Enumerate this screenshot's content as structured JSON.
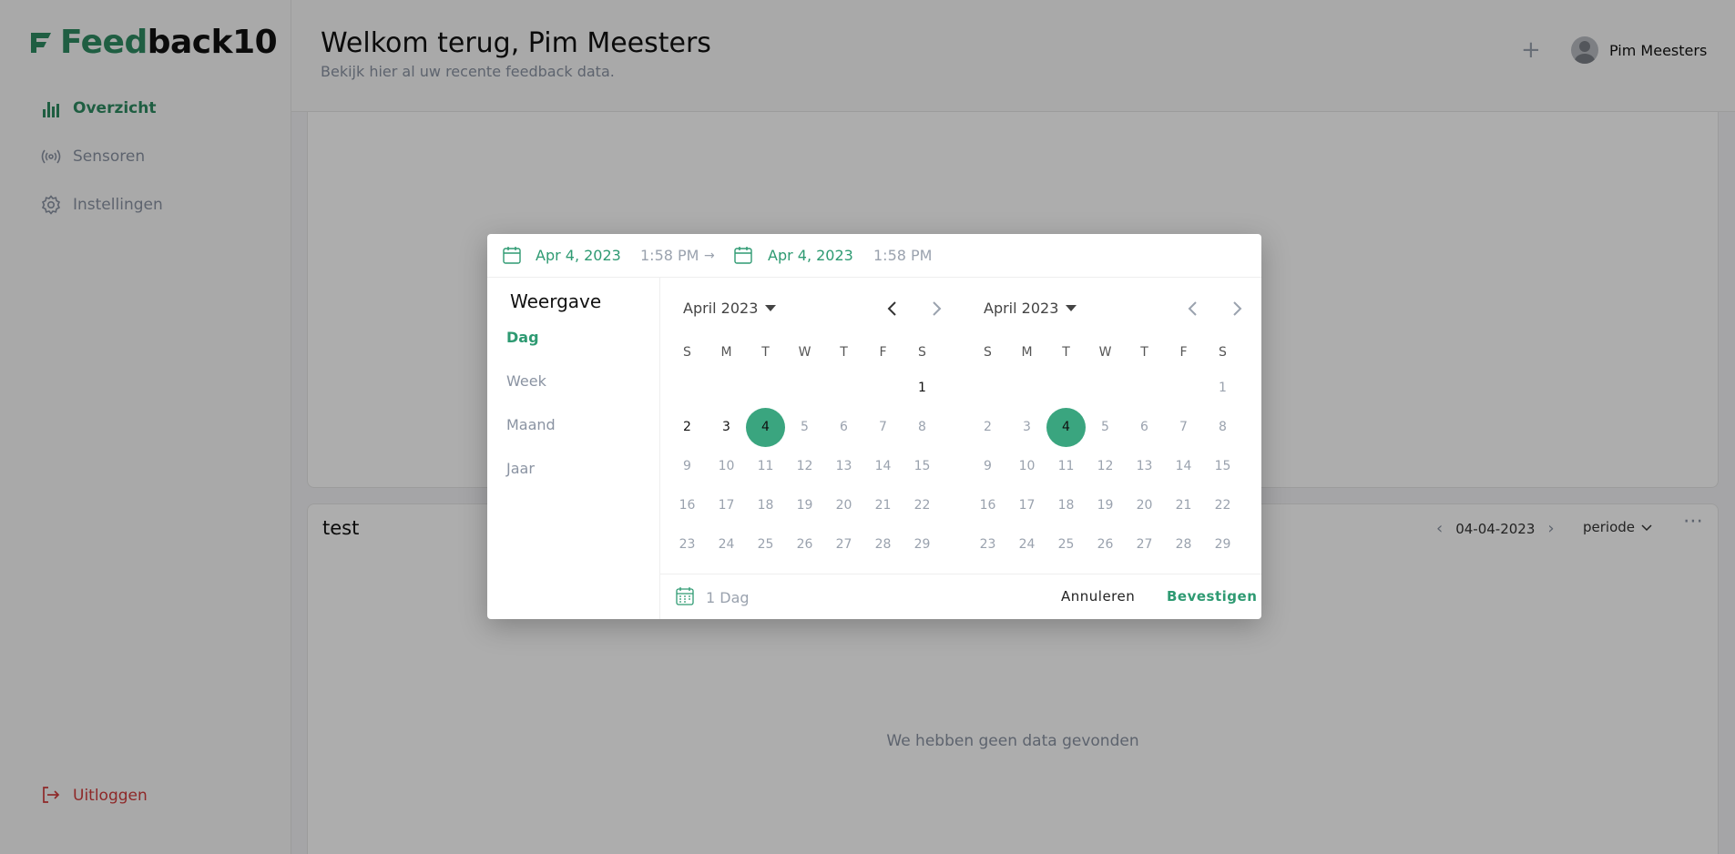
{
  "brand": {
    "name_part1": "Feed",
    "name_part2": "back10",
    "accent": "#2e8b62"
  },
  "sidebar": {
    "items": [
      {
        "label": "Overzicht",
        "icon": "bar-chart-icon",
        "active": true
      },
      {
        "label": "Sensoren",
        "icon": "broadcast-icon",
        "active": false
      },
      {
        "label": "Instellingen",
        "icon": "gear-icon",
        "active": false
      }
    ],
    "logout_label": "Uitloggen"
  },
  "header": {
    "title": "Welkom terug, Pim Meesters",
    "subtitle": "Bekijk hier al uw recente feedback data.",
    "add_label": "+",
    "user_name": "Pim Meesters"
  },
  "widget": {
    "title": "test",
    "date": "04-04-2023",
    "period_label": "periode",
    "empty_text": "We hebben geen data gevonden"
  },
  "picker": {
    "start_date": "Apr 4, 2023",
    "start_time": "1:58 PM",
    "end_date": "Apr 4, 2023",
    "end_time": "1:58 PM",
    "arrow": "→",
    "views_title": "Weergave",
    "views": [
      "Dag",
      "Week",
      "Maand",
      "Jaar"
    ],
    "active_view": "Dag",
    "left_month": "April 2023",
    "right_month": "April 2023",
    "weekdays": [
      "S",
      "M",
      "T",
      "W",
      "T",
      "F",
      "S"
    ],
    "selected_day": 4,
    "duration": "1 Dag",
    "cancel_label": "Annuleren",
    "confirm_label": "Bevestigen"
  }
}
